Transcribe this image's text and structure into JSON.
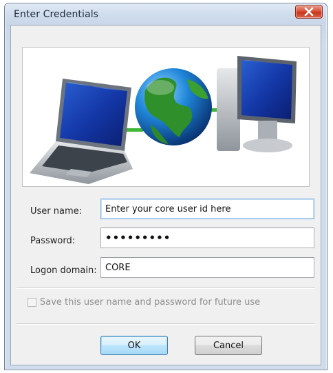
{
  "window": {
    "title": "Enter Credentials",
    "close_icon": "close-icon"
  },
  "banner": {
    "icons": [
      "laptop-icon",
      "globe-icon",
      "desktop-computer-icon"
    ]
  },
  "form": {
    "username_label": "User name:",
    "username_value": "Enter your core user id here",
    "password_label": "Password:",
    "password_value": "•••••••••",
    "domain_label": "Logon domain:",
    "domain_value": "CORE"
  },
  "options": {
    "save_label": "Save this user name and password for future use",
    "save_checked": false,
    "save_enabled": false
  },
  "buttons": {
    "ok_label": "OK",
    "cancel_label": "Cancel"
  },
  "colors": {
    "close_button": "#c8341c",
    "focus_border": "#7eb4ea",
    "default_button_border": "#3c7fb1"
  }
}
